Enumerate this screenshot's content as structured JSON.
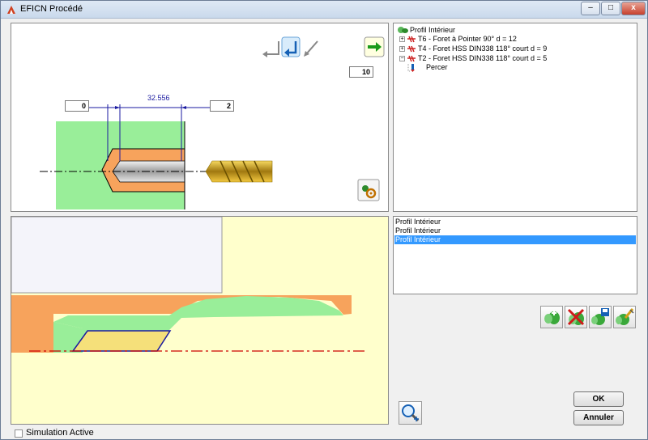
{
  "window": {
    "title": "EFICN Procédé"
  },
  "top_drawing": {
    "input_left": "0",
    "dimension": "32.556",
    "input_right": "2",
    "repeat_count": "10"
  },
  "tree": {
    "root": "Profil Intérieur",
    "items": [
      "T6 - Foret à Pointer 90° d = 12",
      "T4 - Foret HSS DIN338 118° court d = 9",
      "T2 - Foret HSS DIN338 118° court d = 5"
    ],
    "leaf": "Percer"
  },
  "profile_list": {
    "items": [
      "Profil Intérieur",
      "Profil Intérieur",
      "Profil Intérieur"
    ],
    "selected_index": 2
  },
  "buttons": {
    "ok": "OK",
    "cancel": "Annuler"
  },
  "simulation": {
    "label": "Simulation Active",
    "checked": false
  },
  "icons": {
    "window": "eficn-icon",
    "nav": [
      "arrow-left-icon",
      "arrow-return-icon",
      "arrow-diagonal-icon",
      "arrow-right-icon"
    ],
    "tools": [
      "add-tool-icon",
      "delete-tool-icon",
      "save-tool-icon",
      "edit-tool-icon"
    ],
    "zoom": "zoom-in-icon",
    "settings": "gear-icon"
  },
  "colors": {
    "stock": "#99ee99",
    "chip": "#f7a35c",
    "drill": "#d4a017",
    "background_part": "#ffffcc",
    "selection": "#3399ff",
    "axis": "#cc0000"
  }
}
